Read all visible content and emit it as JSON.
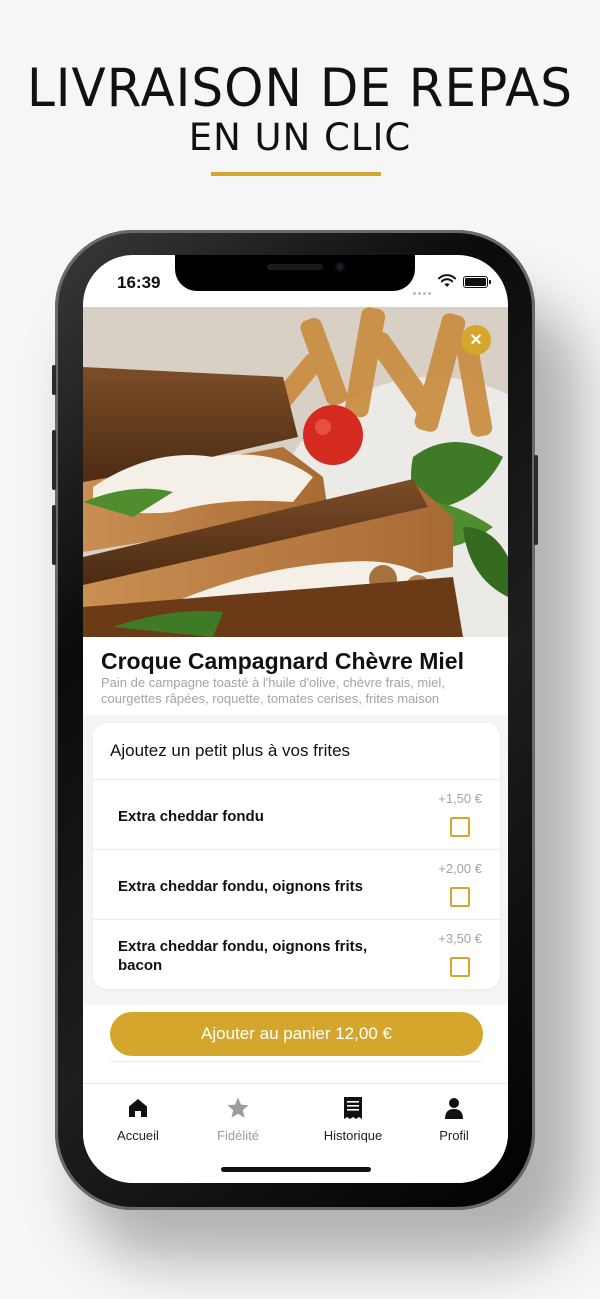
{
  "promo": {
    "title": "LIVRAISON DE REPAS",
    "subtitle": "EN UN CLIC",
    "accent_color": "#d4a72c"
  },
  "status_bar": {
    "time": "16:39",
    "icons": [
      "wifi-icon",
      "battery-icon"
    ]
  },
  "product": {
    "title": "Croque Campagnard Chèvre Miel",
    "description": "Pain de campagne toasté à l'huile d'olive, chèvre frais, miel, courgettes râpées, roquette, tomates cerises, frites maison",
    "close_icon": "×"
  },
  "options": {
    "heading": "Ajoutez un petit plus à vos frites",
    "items": [
      {
        "label": "Extra cheddar fondu",
        "price": "+1,50 €",
        "checked": false
      },
      {
        "label": "Extra cheddar fondu, oignons frits",
        "price": "+2,00 €",
        "checked": false
      },
      {
        "label": "Extra cheddar fondu, oignons frits, bacon",
        "price": "+3,50 €",
        "checked": false
      }
    ]
  },
  "cart": {
    "button_label": "Ajouter au panier 12,00 €"
  },
  "tabbar": {
    "items": [
      {
        "label": "Accueil",
        "icon": "home-icon",
        "active": true
      },
      {
        "label": "Fidélité",
        "icon": "star-icon",
        "active": false
      },
      {
        "label": "Historique",
        "icon": "receipt-icon",
        "active": true
      },
      {
        "label": "Profil",
        "icon": "person-icon",
        "active": true
      }
    ]
  }
}
